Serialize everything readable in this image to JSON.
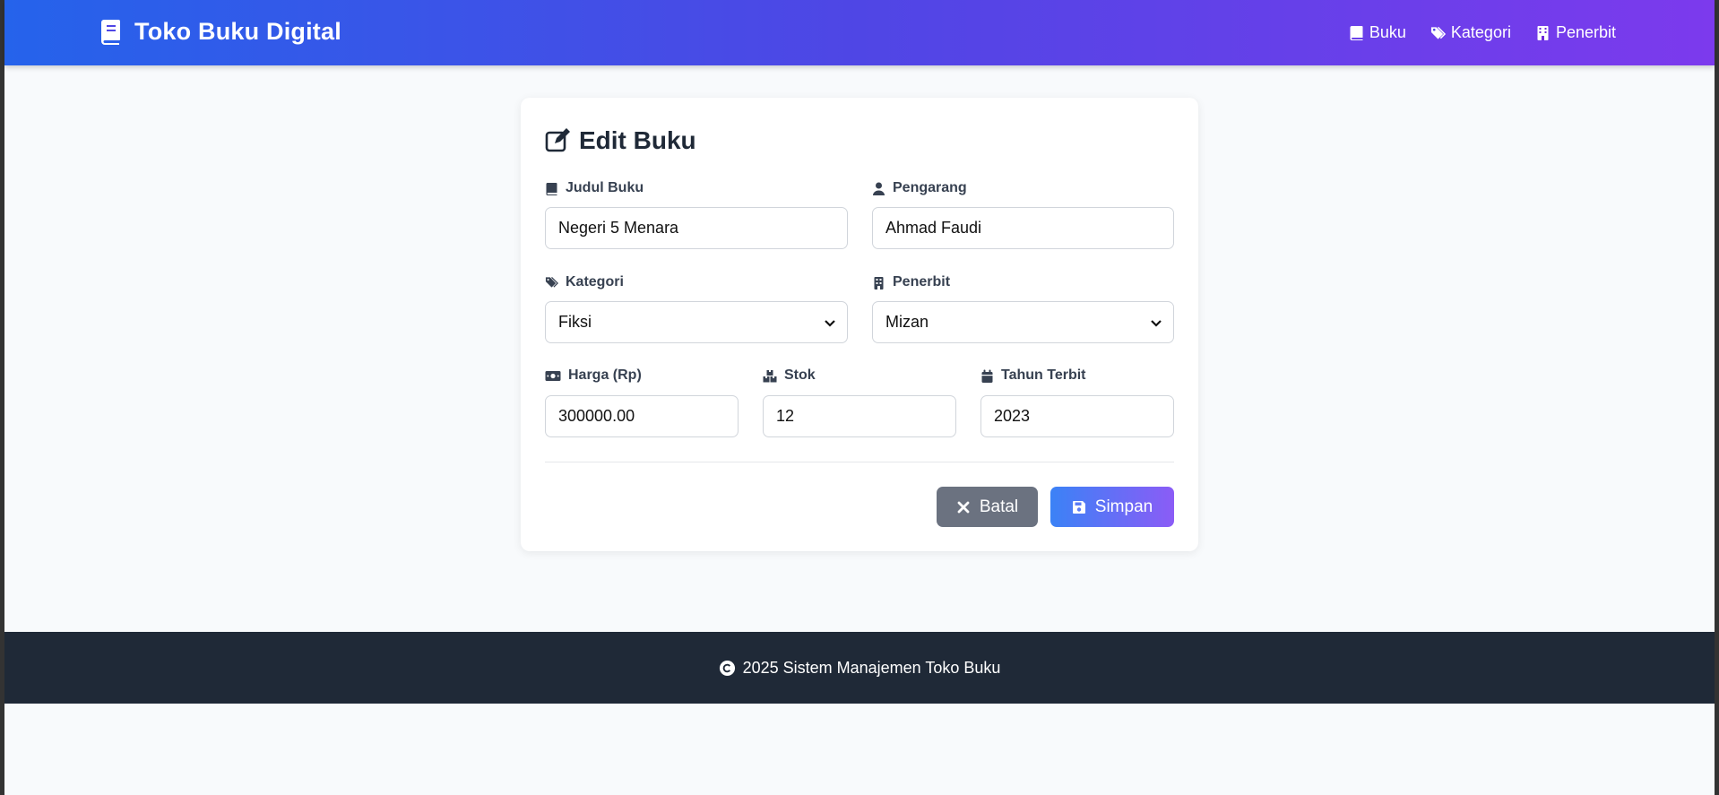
{
  "header": {
    "brand": "Toko Buku Digital",
    "nav": [
      {
        "label": "Buku",
        "icon": "book-icon"
      },
      {
        "label": "Kategori",
        "icon": "tags-icon"
      },
      {
        "label": "Penerbit",
        "icon": "building-icon"
      }
    ]
  },
  "form": {
    "title": "Edit Buku",
    "fields": {
      "judul": {
        "label": "Judul Buku",
        "value": "Negeri 5 Menara"
      },
      "pengarang": {
        "label": "Pengarang",
        "value": "Ahmad Faudi"
      },
      "kategori": {
        "label": "Kategori",
        "value": "Fiksi"
      },
      "penerbit": {
        "label": "Penerbit",
        "value": "Mizan"
      },
      "harga": {
        "label": "Harga (Rp)",
        "value": "300000.00"
      },
      "stok": {
        "label": "Stok",
        "value": "12"
      },
      "tahun": {
        "label": "Tahun Terbit",
        "value": "2023"
      }
    },
    "buttons": {
      "cancel": "Batal",
      "save": "Simpan"
    }
  },
  "footer": {
    "text": "2025 Sistem Manajemen Toko Buku"
  },
  "colors": {
    "header_gradient_start": "#2563eb",
    "header_gradient_end": "#7c3aed",
    "cancel_button": "#6b7280",
    "save_button_start": "#3b82f6",
    "save_button_end": "#8b5cf6",
    "footer_bg": "#1f2937"
  }
}
